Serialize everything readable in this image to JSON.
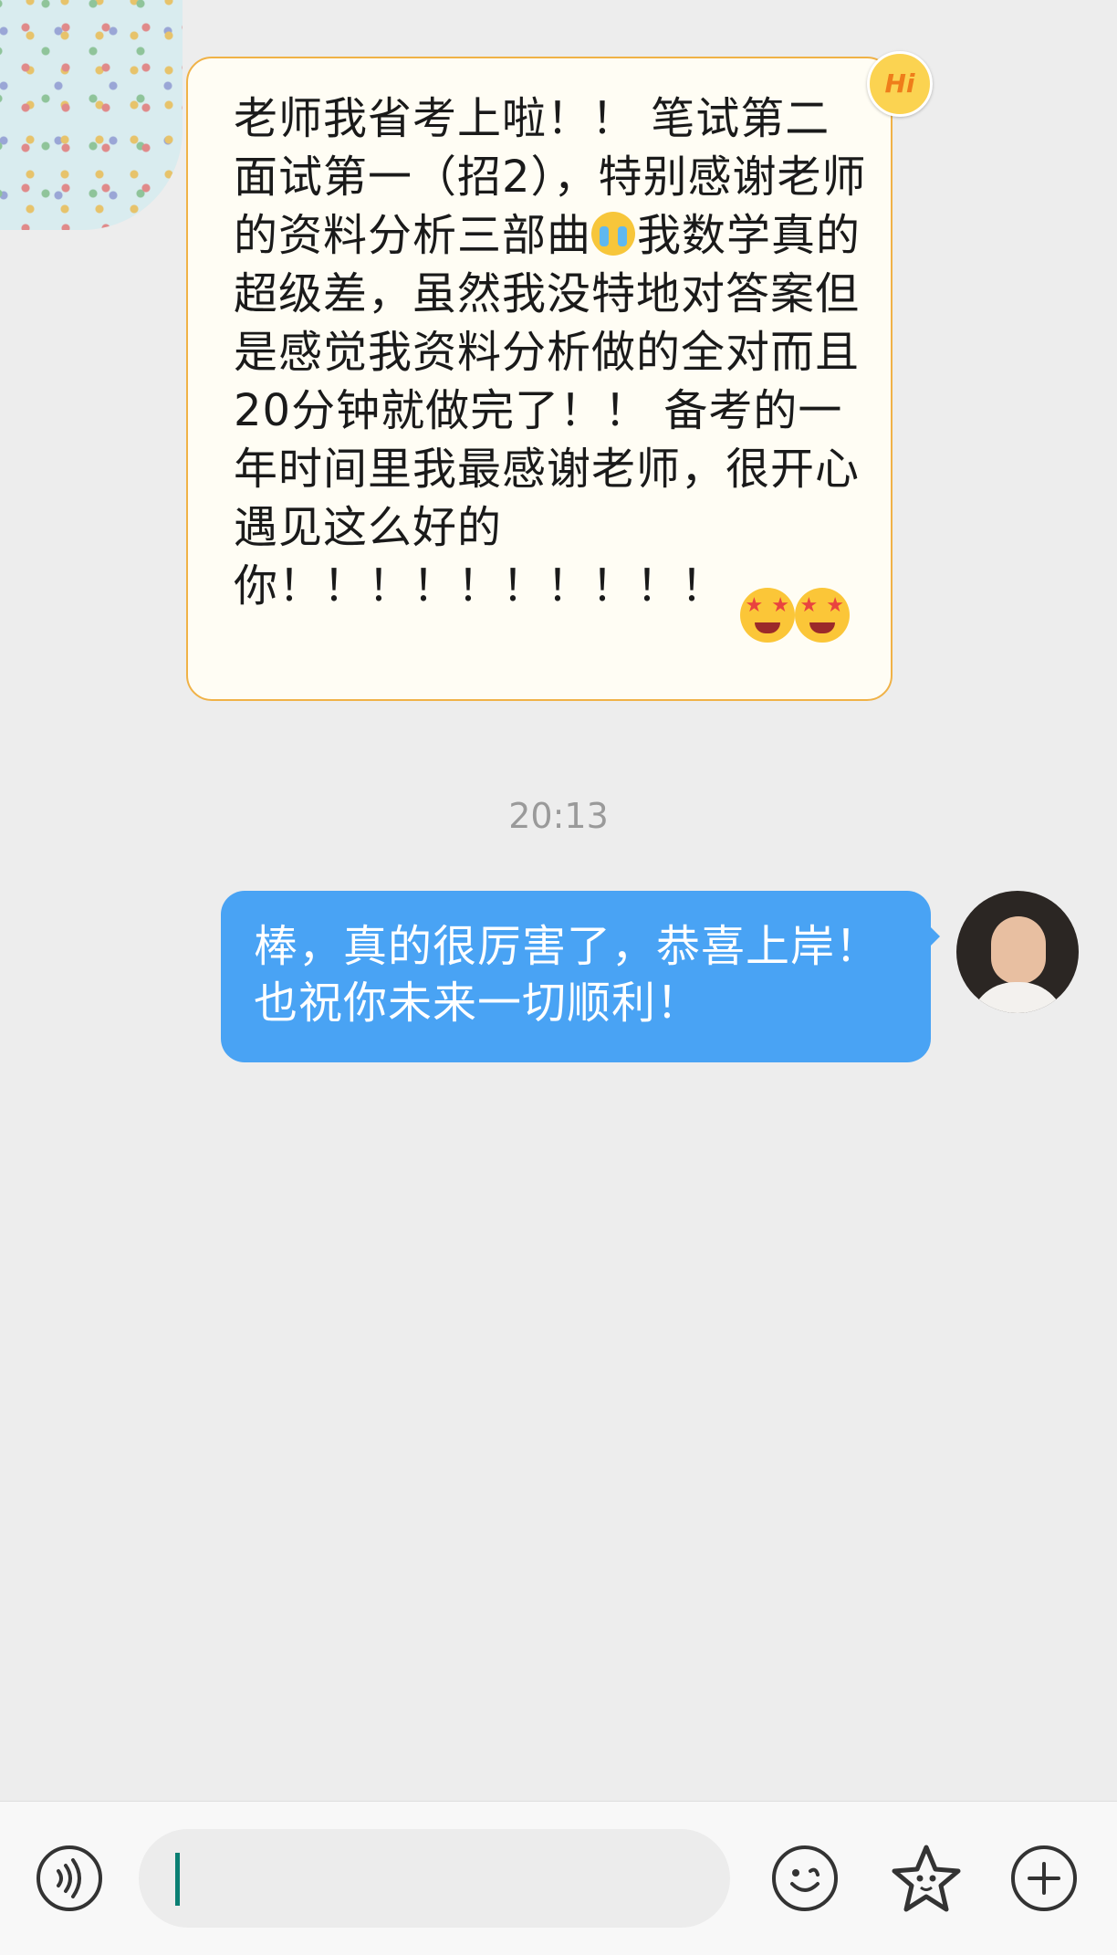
{
  "messages": [
    {
      "side": "left",
      "text_a": "老师我省考上啦！！ 笔试第二面试第一（招2），特别感谢老师的资料分析三部曲",
      "text_b": "我数学真的超级差，虽然我没特地对答案但是感觉我资料分析做的全对而且20分钟就做完了！！ 备考的一年时间里我最感谢老师，很开心遇见这么好的你！！！！！！！！！！ ",
      "badge": "Hi",
      "emojis": [
        "crying-face",
        "star-struck",
        "star-struck"
      ]
    },
    {
      "side": "right",
      "text": "棒，真的很厉害了，恭喜上岸！也祝你未来一切顺利！"
    }
  ],
  "timestamp": "20:13",
  "colors": {
    "background": "#ededed",
    "incoming_bubble": "#fffdf4",
    "incoming_border": "#f0b247",
    "outgoing_bubble": "#49a3f4",
    "cursor": "#0a7f73"
  },
  "input_bar": {
    "icons": [
      "voice-icon",
      "emoji-icon",
      "sticker-icon",
      "plus-icon"
    ]
  }
}
